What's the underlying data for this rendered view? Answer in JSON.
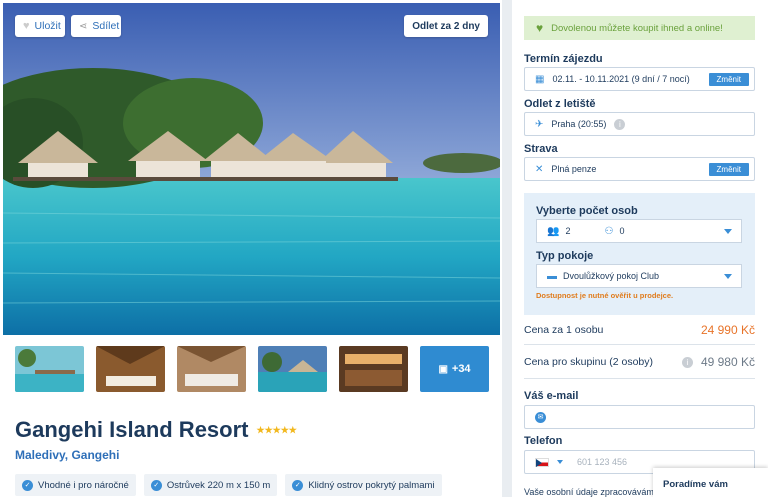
{
  "hero": {
    "save_label": "Uložit",
    "share_label": "Sdílet",
    "departure_badge": "Odlet za 2 dny"
  },
  "gallery": {
    "more_label": "+34"
  },
  "hotel": {
    "name": "Gangehi Island Resort",
    "stars": "★★★★★",
    "location": "Maledivy, Gangehi",
    "tags": [
      "Vhodné i pro náročné",
      "Ostrůvek 220 m x 150 m",
      "Klidný ostrov pokrytý palmami"
    ]
  },
  "booking": {
    "banner": "Dovolenou můžete koupit ihned a online!",
    "term_label": "Termín zájezdu",
    "term_value": "02.11. - 10.11.2021 (9 dní / 7 nocí)",
    "change_label": "Změnit",
    "departure_label": "Odlet z letiště",
    "departure_value": "Praha (20:55)",
    "board_label": "Strava",
    "board_value": "Plná penze",
    "persons_label": "Vyberte počet osob",
    "adults": "2",
    "children": "0",
    "room_label": "Typ pokoje",
    "room_value": "Dvoulůžkový pokoj Club",
    "availability_note": "Dostupnost je nutné ověřit u prodejce.",
    "price_per_person_label": "Cena za 1 osobu",
    "price_per_person": "24 990 Kč",
    "price_group_label": "Cena pro skupinu (2 osoby)",
    "price_group": "49 980 Kč",
    "email_label": "Váš e-mail",
    "phone_label": "Telefon",
    "phone_placeholder": "601 123 456",
    "privacy_note": "Vaše osobní údaje zpracováváme",
    "advise_label": "Poradíme vám"
  },
  "colors": {
    "accent": "#3a8ed6",
    "price": "#e8742a",
    "banner_bg": "#dff0d1",
    "banner_text": "#6aa13c"
  }
}
